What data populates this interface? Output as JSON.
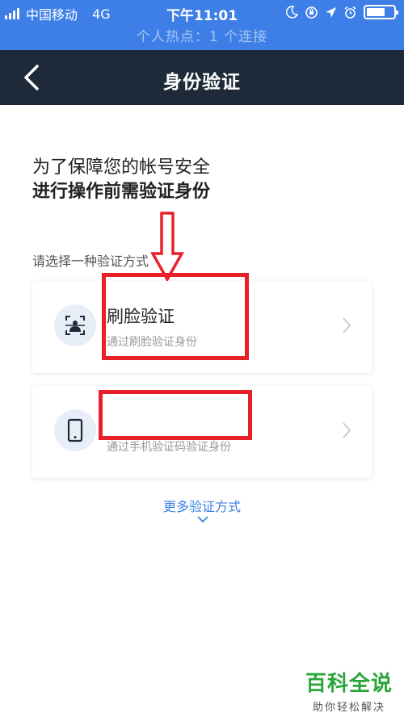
{
  "status_bar": {
    "carrier": "中国移动",
    "network": "4G",
    "time": "下午11:01"
  },
  "hotspot": "个人热点：1 个连接",
  "nav": {
    "title": "身份验证"
  },
  "intro": {
    "line1": "为了保障您的帐号安全",
    "line2": "进行操作前需验证身份"
  },
  "section_label": "请选择一种验证方式",
  "options": [
    {
      "title": "刷脸验证",
      "desc": "通过刷脸验证身份",
      "icon": "face-scan-icon"
    },
    {
      "title": "",
      "desc": "通过手机验证码验证身份",
      "icon": "phone-icon"
    }
  ],
  "more_label": "更多验证方式",
  "watermark": {
    "main": "百科全说",
    "sub": "助你轻松解决"
  },
  "colors": {
    "status_blue": "#3d7fe6",
    "nav_dark": "#1e2a3a",
    "link_blue": "#3d7fe6",
    "annotation_red": "#e8202a",
    "watermark_green": "#2aa53a"
  }
}
